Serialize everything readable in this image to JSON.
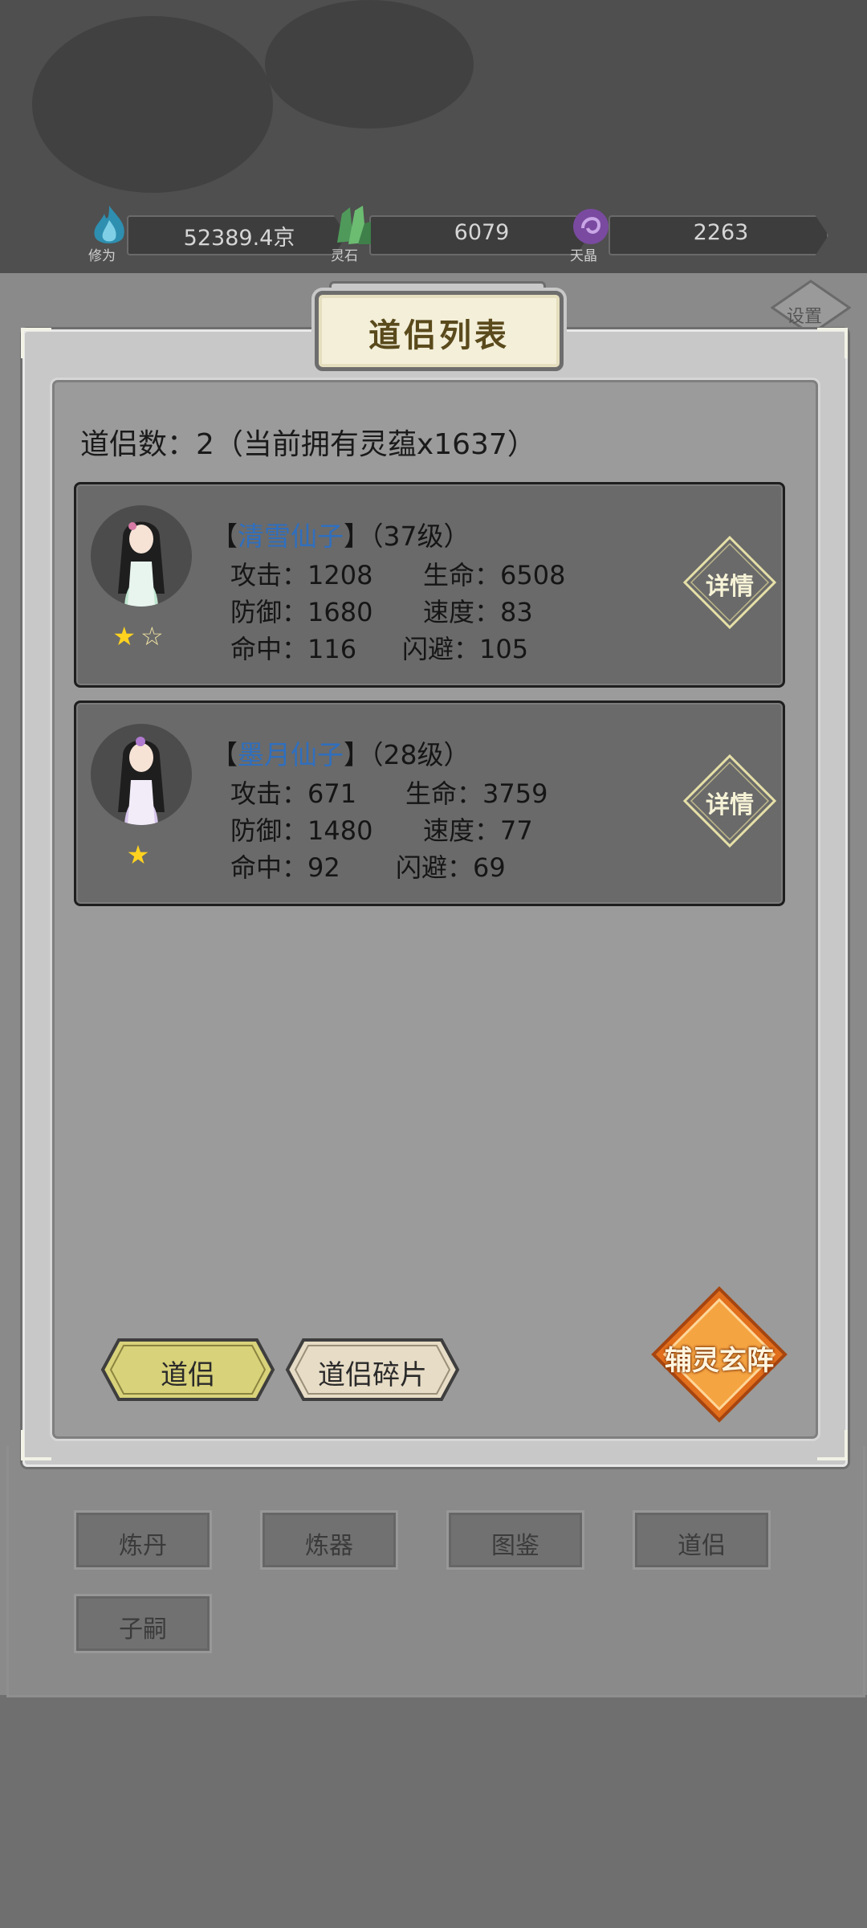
{
  "resources": [
    {
      "label": "修为",
      "value": "52389.4京",
      "icon": "cultivation-flame-icon",
      "color": "#2e8fb0"
    },
    {
      "label": "灵石",
      "value": "6079",
      "icon": "spirit-stone-icon",
      "color": "#4f9a5a"
    },
    {
      "label": "天晶",
      "value": "2263",
      "icon": "heaven-crystal-icon",
      "color": "#7a4aa0"
    }
  ],
  "settings": {
    "label": "设置"
  },
  "panel": {
    "title": "道侣列表",
    "count_label": "道侣数：2（当前拥有灵蕴x1637）"
  },
  "companions": [
    {
      "bracket_open": "【",
      "name": "清雪仙子",
      "bracket_close": "】",
      "level": "（37级）",
      "stars_full": "★",
      "stars_empty": "☆",
      "attack": "攻击：1208",
      "hp": "生命：6508",
      "defense": "防御：1680",
      "speed": "速度：83",
      "hit": "命中：116",
      "dodge": "闪避：105",
      "detail_label": "详情"
    },
    {
      "bracket_open": "【",
      "name": "墨月仙子",
      "bracket_close": "】",
      "level": "（28级）",
      "stars_full": "★",
      "stars_empty": "",
      "attack": "攻击：671",
      "hp": "生命：3759",
      "defense": "防御：1480",
      "speed": "速度：77",
      "hit": "命中：92",
      "dodge": "闪避：69",
      "detail_label": "详情"
    }
  ],
  "tabs": {
    "companion": "道侣",
    "fragments": "道侣碎片"
  },
  "formation_button": "辅灵玄阵",
  "menu": [
    "炼丹",
    "炼器",
    "图鉴",
    "道侣",
    "子嗣"
  ],
  "colors": {
    "name_blue": "#2f6fbf",
    "star_gold": "#ffd21f",
    "active_tab": "#d8d27a",
    "formation_orange": "#f08a2a"
  }
}
